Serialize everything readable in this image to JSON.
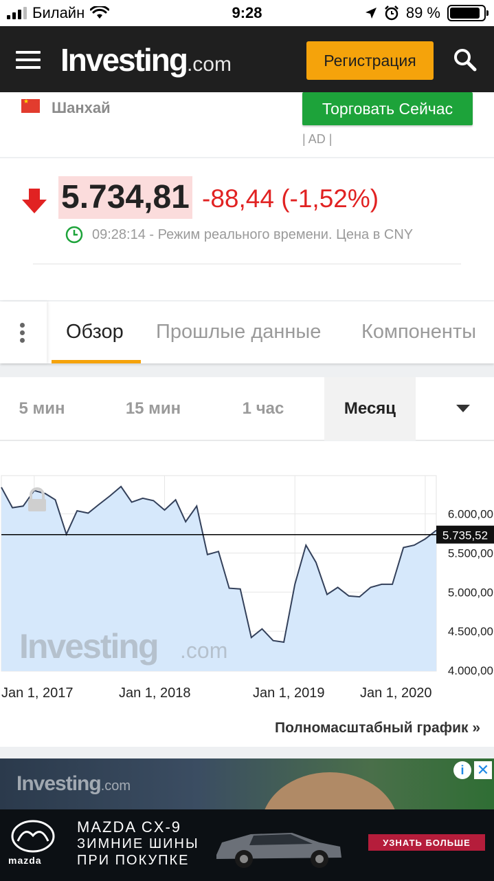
{
  "status_bar": {
    "carrier": "Билайн",
    "time": "9:28",
    "battery": "89 %",
    "battery_level": 0.89
  },
  "header": {
    "logo_main": "Investing",
    "logo_suffix": ".com",
    "register_label": "Регистрация"
  },
  "instrument": {
    "exchange": "Шанхай",
    "trade_label": "Торговать Сейчас",
    "ad_tag": "| AD |",
    "price": "5.734,81",
    "change": "-88,44 (-1,52%)",
    "realtime_note": "09:28:14 - Режим реального времени. Цена в CNY",
    "colors": {
      "down": "#e12222",
      "price_bg": "#fbdcdc",
      "accent": "#f5a30b",
      "trade": "#1da33a"
    }
  },
  "tabs": [
    {
      "label": "Обзор",
      "active": true
    },
    {
      "label": "Прошлые данные",
      "active": false
    },
    {
      "label": "Компоненты",
      "active": false
    }
  ],
  "timeframes": [
    {
      "label": "5 мин",
      "active": false
    },
    {
      "label": "15 мин",
      "active": false
    },
    {
      "label": "1 час",
      "active": false
    },
    {
      "label": "Месяц",
      "active": true
    }
  ],
  "chart_data": {
    "type": "area",
    "x_labels": [
      "Jan 1, 2017",
      "Jan 1, 2018",
      "Jan 1, 2019",
      "Jan 1, 2020"
    ],
    "y_ticks": [
      "6.000,00",
      "5.500,00",
      "5.000,00",
      "4.500,00",
      "4.000,00"
    ],
    "y_tick_values": [
      6000,
      5500,
      5000,
      4500,
      4000
    ],
    "ylim": [
      3990,
      6490
    ],
    "x_range": [
      "2016-10-01",
      "2020-02-01"
    ],
    "current_value": 5735.52,
    "current_label": "5.735,52",
    "watermark_main": "Investing",
    "watermark_suffix": ".com",
    "grid": true,
    "series": [
      {
        "x": [
          "2016-10",
          "2016-11",
          "2016-12",
          "2017-01",
          "2017-02",
          "2017-03",
          "2017-04",
          "2017-05",
          "2017-06",
          "2017-07",
          "2017-08",
          "2017-09",
          "2017-10",
          "2017-11",
          "2017-12",
          "2018-01",
          "2018-02",
          "2018-03",
          "2018-04",
          "2018-05",
          "2018-06",
          "2018-07",
          "2018-08",
          "2018-09",
          "2018-10",
          "2018-11",
          "2018-12",
          "2019-01",
          "2019-02",
          "2019-03",
          "2019-04",
          "2019-05",
          "2019-06",
          "2019-07",
          "2019-08",
          "2019-09",
          "2019-10",
          "2019-11",
          "2019-12",
          "2020-01",
          "2020-02"
        ],
        "values": [
          6340,
          6080,
          6100,
          6300,
          6260,
          6180,
          5740,
          6040,
          6010,
          6120,
          6230,
          6350,
          6150,
          6200,
          6170,
          6050,
          6180,
          5900,
          6100,
          5480,
          5520,
          5050,
          5040,
          4420,
          4530,
          4380,
          4360,
          5100,
          5600,
          5380,
          4970,
          5060,
          4950,
          4940,
          5060,
          5100,
          5100,
          5570,
          5600,
          5680,
          5790
        ]
      }
    ]
  },
  "full_chart_link": "Полномасштабный график »",
  "ad": {
    "site_logo_main": "Investing",
    "site_logo_suffix": ".com",
    "brand": "mazda",
    "line1": "MAZDA CX-9",
    "line2": "ЗИМНИЕ ШИНЫ",
    "line3": "ПРИ ПОКУПКЕ",
    "cta": "УЗНАТЬ БОЛЬШЕ"
  }
}
